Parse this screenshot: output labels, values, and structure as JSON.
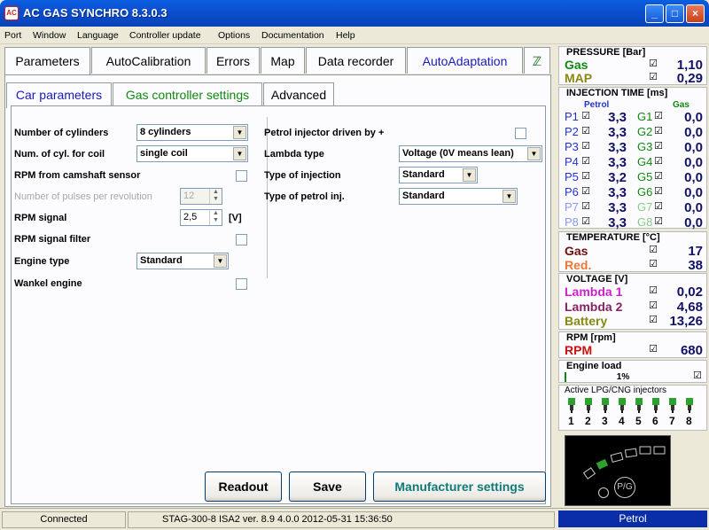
{
  "window": {
    "title": "AC GAS SYNCHRO  8.3.0.3",
    "icon": "AC",
    "buttons": {
      "min": "_",
      "max": "□",
      "close": "×"
    }
  },
  "menu": [
    "Port",
    "Window",
    "Language",
    "Controller update",
    "Options",
    "Documentation",
    "Help"
  ],
  "top_tabs": [
    "Parameters",
    "AutoCalibration",
    "Errors",
    "Map",
    "Data recorder",
    "AutoAdaptation"
  ],
  "sub_tabs": [
    "Car parameters",
    "Gas controller settings",
    "Advanced"
  ],
  "left_params": {
    "cylinders_label": "Number of cylinders",
    "cylinders_value": "8 cylinders",
    "cyl_coil_label": "Num. of cyl. for coil",
    "cyl_coil_value": "single coil",
    "rpm_cam_label": "RPM from camshaft sensor",
    "pulses_label": "Number of pulses per revolution",
    "pulses_value": "12",
    "rpm_signal_label": "RPM signal",
    "rpm_signal_value": "2,5",
    "rpm_signal_unit": "[V]",
    "rpm_filter_label": "RPM signal filter",
    "engine_type_label": "Engine type",
    "engine_type_value": "Standard",
    "wankel_label": "Wankel engine"
  },
  "right_params": {
    "petrol_inj_label": "Petrol injector driven by +",
    "lambda_label": "Lambda type",
    "lambda_value": "Voltage  (0V means lean)",
    "inj_type_label": "Type of injection",
    "inj_type_value": "Standard",
    "petrol_inj_type_label": "Type of petrol inj.",
    "petrol_inj_type_value": "Standard"
  },
  "buttons": {
    "readout": "Readout",
    "save": "Save",
    "manufacturer": "Manufacturer settings"
  },
  "status": {
    "connection": "Connected",
    "device": "STAG-300-8 ISA2  ver. 8.9  4.0.0   2012-05-31 15:36:50",
    "fuel": "Petrol"
  },
  "pressure": {
    "title": "PRESSURE [Bar]",
    "gas_label": "Gas",
    "gas_value": "1,10",
    "map_label": "MAP",
    "map_value": "0,29"
  },
  "injection": {
    "title": "INJECTION TIME [ms]",
    "petrol_header": "Petrol",
    "gas_header": "Gas",
    "rows": [
      {
        "p": "P1",
        "pv": "3,3",
        "g": "G1",
        "gv": "0,0"
      },
      {
        "p": "P2",
        "pv": "3,3",
        "g": "G2",
        "gv": "0,0"
      },
      {
        "p": "P3",
        "pv": "3,3",
        "g": "G3",
        "gv": "0,0"
      },
      {
        "p": "P4",
        "pv": "3,3",
        "g": "G4",
        "gv": "0,0"
      },
      {
        "p": "P5",
        "pv": "3,2",
        "g": "G5",
        "gv": "0,0"
      },
      {
        "p": "P6",
        "pv": "3,3",
        "g": "G6",
        "gv": "0,0"
      },
      {
        "p": "P7",
        "pv": "3,3",
        "g": "G7",
        "gv": "0,0"
      },
      {
        "p": "P8",
        "pv": "3,3",
        "g": "G8",
        "gv": "0,0"
      }
    ]
  },
  "temperature": {
    "title": "TEMPERATURE [°C]",
    "gas_label": "Gas",
    "gas_value": "17",
    "red_label": "Red.",
    "red_value": "38"
  },
  "voltage": {
    "title": "VOLTAGE [V]",
    "l1_label": "Lambda 1",
    "l1_value": "0,02",
    "l2_label": "Lambda 2",
    "l2_value": "4,68",
    "bat_label": "Battery",
    "bat_value": "13,26"
  },
  "rpm": {
    "title": "RPM [rpm]",
    "label": "RPM",
    "value": "680"
  },
  "engine_load": {
    "title": "Engine load",
    "value": "1%"
  },
  "active_inj": {
    "title": "Active LPG/CNG injectors",
    "numbers": [
      "1",
      "2",
      "3",
      "4",
      "5",
      "6",
      "7",
      "8"
    ]
  },
  "switch": {
    "label": "P/G"
  },
  "colors": {
    "petrol_row": "#2233cc",
    "gas_row": "#118811",
    "pressure_gas": "#118811",
    "map": "#888811",
    "temp_gas": "#6a1010",
    "temp_red": "#ee7733",
    "lambda1": "#cc22cc",
    "lambda2": "#882266",
    "battery": "#888811",
    "rpm": "#cc1111"
  }
}
